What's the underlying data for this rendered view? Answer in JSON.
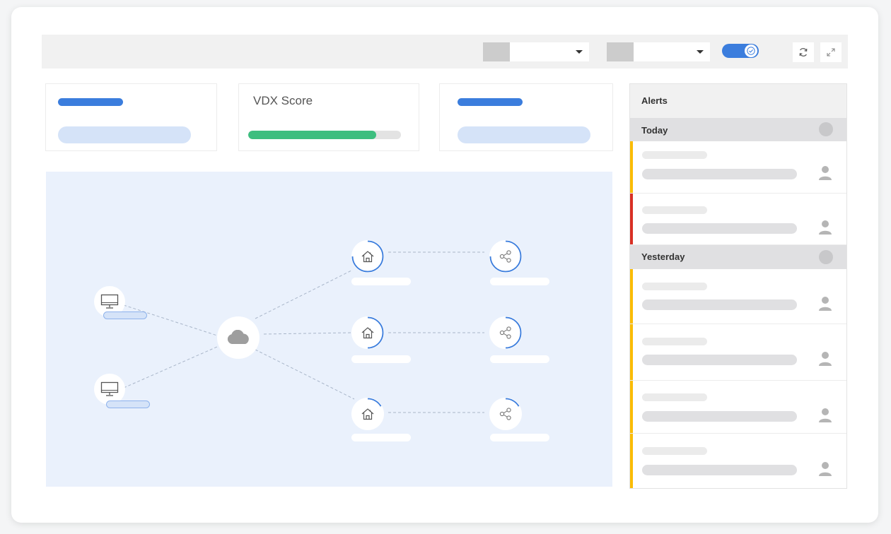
{
  "toolbar": {
    "toggle_on": true,
    "accent": "#3b7ddd",
    "icons": [
      "refresh-icon",
      "expand-icon"
    ]
  },
  "score": {
    "label": "VDX Score",
    "value_fraction": 0.84,
    "color": "#3dbe7f"
  },
  "alerts": {
    "title": "Alerts",
    "groups": [
      {
        "title": "Today",
        "items": [
          {
            "severity": "warning",
            "color": "#fbbc04"
          },
          {
            "severity": "critical",
            "color": "#d93025"
          }
        ]
      },
      {
        "title": "Yesterday",
        "items": [
          {
            "severity": "warning",
            "color": "#fbbc04"
          },
          {
            "severity": "warning",
            "color": "#fbbc04"
          },
          {
            "severity": "warning",
            "color": "#fbbc04"
          },
          {
            "severity": "warning",
            "color": "#fbbc04"
          }
        ]
      }
    ]
  },
  "diagram": {
    "nodes": [
      "desktop-icon",
      "desktop-icon",
      "cloud-icon",
      "home-icon",
      "home-icon",
      "home-icon",
      "share-icon",
      "share-icon",
      "share-icon"
    ]
  }
}
